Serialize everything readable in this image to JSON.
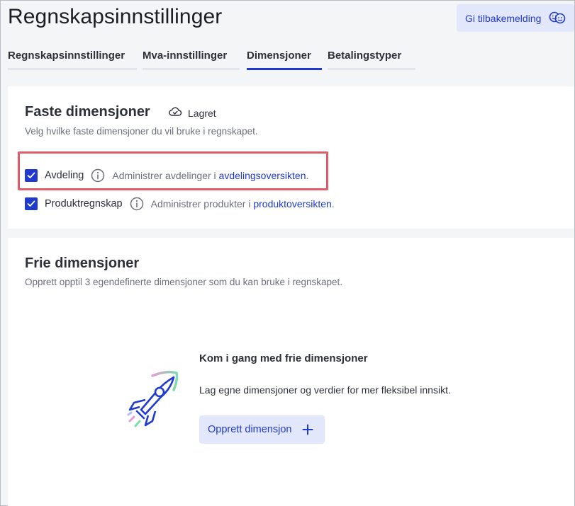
{
  "header": {
    "title": "Regnskapsinnstillinger",
    "feedback_label": "Gi tilbakemelding",
    "feedback_icon": "smiley-faces-icon"
  },
  "tabs": [
    {
      "label": "Regnskapsinnstillinger",
      "active": false
    },
    {
      "label": "Mva-innstillinger",
      "active": false
    },
    {
      "label": "Dimensjoner",
      "active": true
    },
    {
      "label": "Betalingstyper",
      "active": false
    }
  ],
  "fixed_dimensions": {
    "title": "Faste dimensjoner",
    "status": "Lagret",
    "status_icon": "cloud-check-icon",
    "subtitle": "Velg hvilke faste dimensjoner du vil bruke i regnskapet.",
    "items": [
      {
        "label": "Avdeling",
        "checked": true,
        "desc_prefix": "Administrer avdelinger i ",
        "link_text": "avdelingsoversikten",
        "desc_suffix": "."
      },
      {
        "label": "Produktregnskap",
        "checked": true,
        "desc_prefix": "Administrer produkter i ",
        "link_text": "produktoversikten",
        "desc_suffix": "."
      }
    ]
  },
  "free_dimensions": {
    "title": "Frie dimensjoner",
    "subtitle": "Opprett opptil 3 egendefinerte dimensjoner som du kan bruke i regnskapet.",
    "empty_title": "Kom i gang med frie dimensjoner",
    "empty_desc": "Lag egne dimensjoner og verdier for mer fleksibel innsikt.",
    "create_label": "Opprett dimensjon",
    "illustration": "rocket-illustration"
  },
  "colors": {
    "accent": "#1f3ad1",
    "accent_light": "#e3e7fb",
    "highlight": "#df5d6a",
    "background": "#f4f5f7"
  }
}
